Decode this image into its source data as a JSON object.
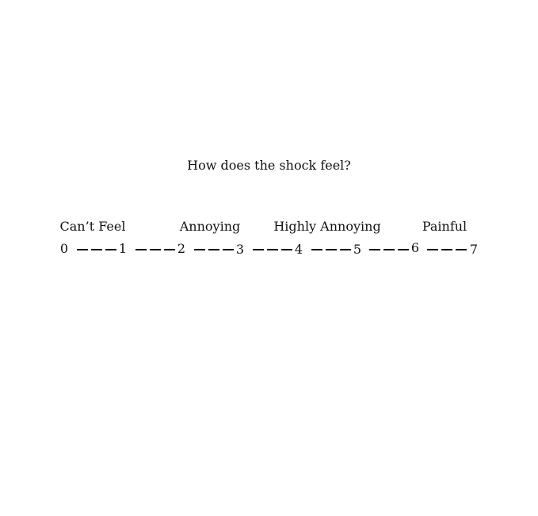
{
  "question": "How does the shock feel?",
  "anchors": [
    {
      "label": "Can’t Feel",
      "at": 0.5
    },
    {
      "label": "Annoying",
      "at": 2.5
    },
    {
      "label": "Highly Annoying",
      "at": 4.5
    },
    {
      "label": "Painful",
      "at": 6.5
    }
  ],
  "scale": {
    "min": 0,
    "max": 7,
    "points": [
      "0",
      "1",
      "2",
      "3",
      "4",
      "5",
      "6",
      "7"
    ]
  }
}
